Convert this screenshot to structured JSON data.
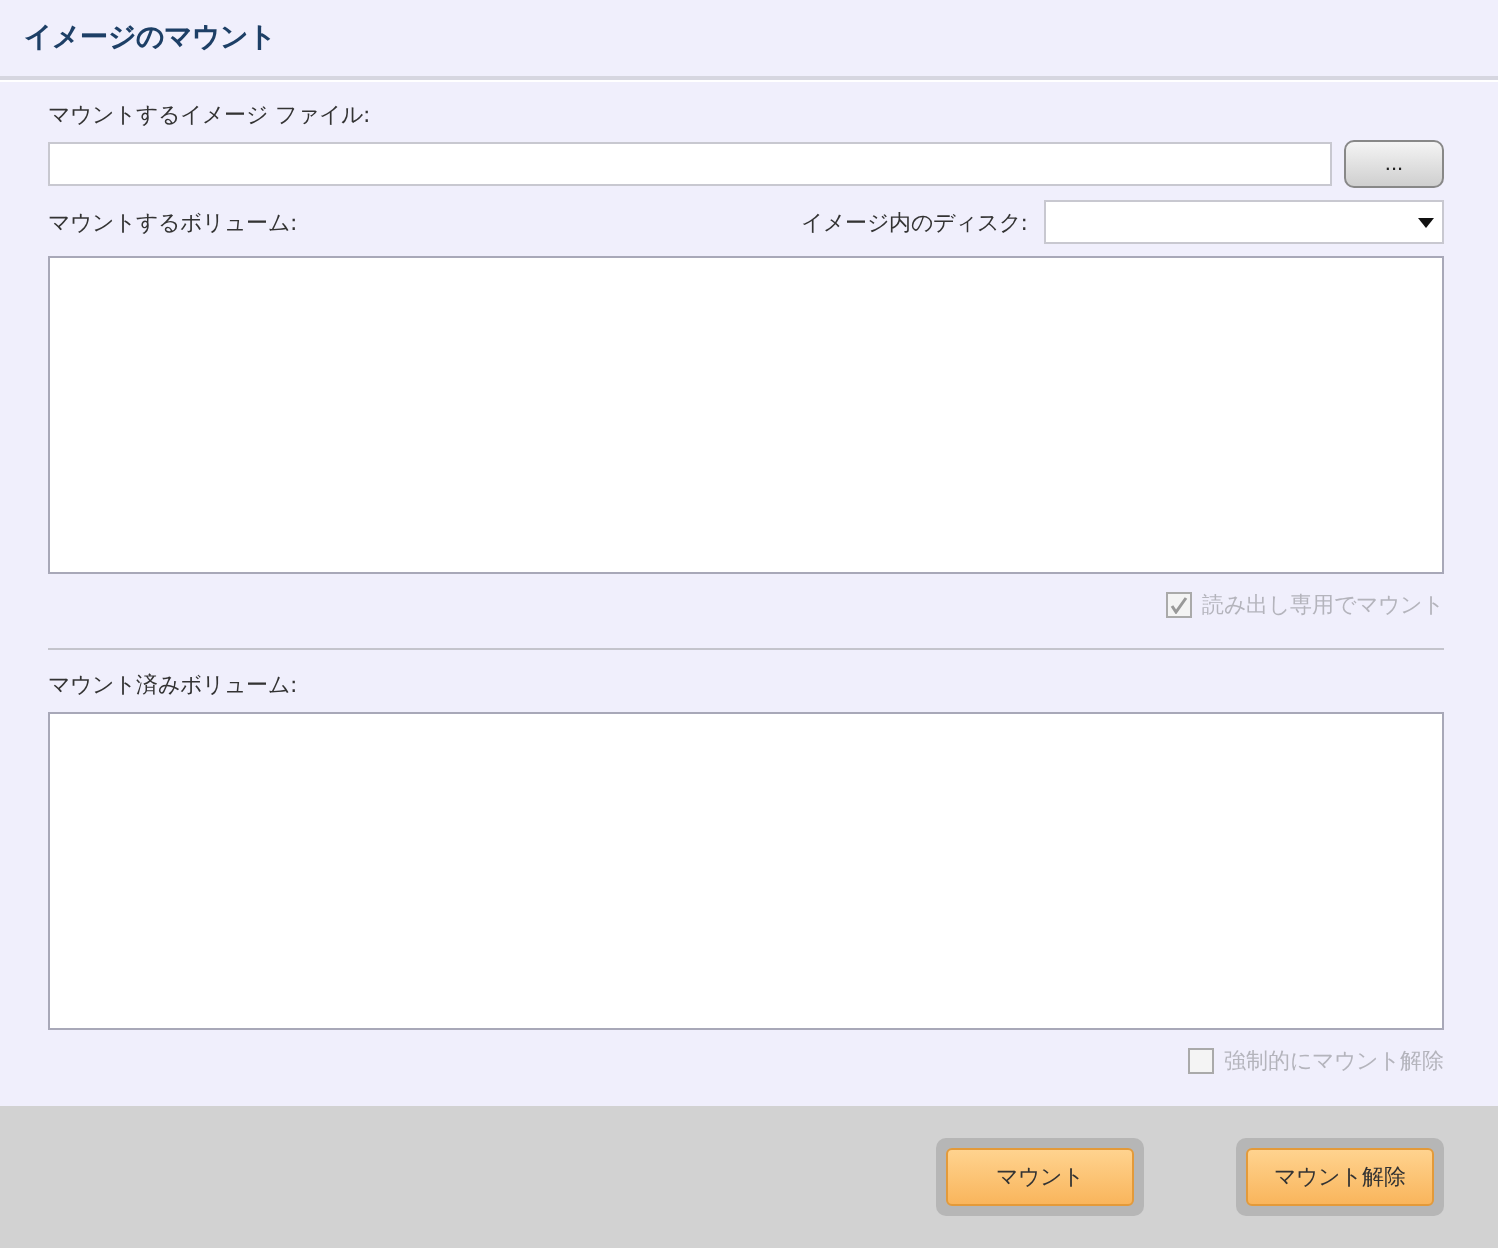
{
  "window": {
    "title": "イメージのマウント"
  },
  "image_file": {
    "label": "マウントするイメージ ファイル:",
    "browse_button": "..."
  },
  "volume": {
    "label": "マウントするボリューム:",
    "disk_label": "イメージ内のディスク:"
  },
  "read_only": {
    "label": "読み出し専用でマウント",
    "checked": true,
    "disabled": true
  },
  "mounted": {
    "label": "マウント済みボリューム:"
  },
  "force_unmount": {
    "label": "強制的にマウント解除",
    "checked": false,
    "disabled": true
  },
  "buttons": [
    "マウント",
    "マウント解除"
  ]
}
